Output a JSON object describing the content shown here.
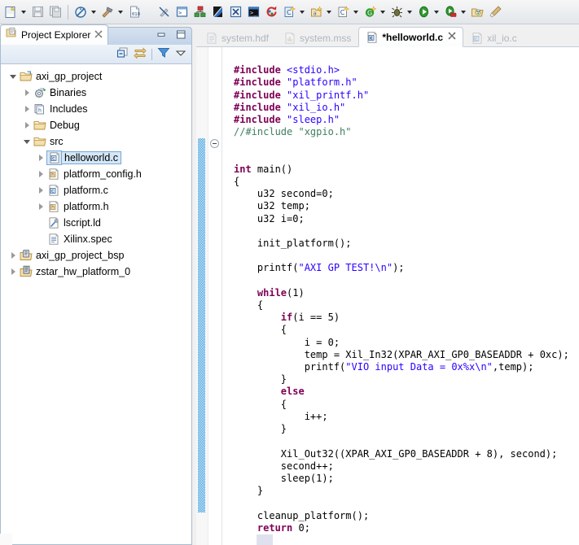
{
  "toolbar": {
    "items": [
      {
        "name": "new-button",
        "icon": "new-file-icon",
        "dropdown": true
      },
      {
        "name": "save-button",
        "icon": "save-icon",
        "dropdown": false
      },
      {
        "name": "save-all-button",
        "icon": "save-all-icon",
        "dropdown": false
      },
      {
        "name": "separator-1",
        "icon": "separator",
        "dropdown": false
      },
      {
        "name": "skip-breakpoints-button",
        "icon": "skip-breakpoints-icon",
        "dropdown": true
      },
      {
        "name": "build-button",
        "icon": "hammer-build-icon",
        "dropdown": true
      },
      {
        "name": "binary-editor-button",
        "icon": "binary-file-icon",
        "dropdown": false
      },
      {
        "name": "spacer-1",
        "icon": "gap",
        "dropdown": false
      },
      {
        "name": "toggle-markers-button",
        "icon": "crossed-pencil-icon",
        "dropdown": false
      },
      {
        "name": "terminal-button",
        "icon": "terminal-icon",
        "dropdown": false
      },
      {
        "name": "program-fpga-button",
        "icon": "green-blocks-icon",
        "dropdown": false
      },
      {
        "name": "xsct-console-button",
        "icon": "blue-diagonal-icon",
        "dropdown": false
      },
      {
        "name": "xilinx-tools-button",
        "icon": "xilinx-x-icon",
        "dropdown": false
      },
      {
        "name": "launch-shell-button",
        "icon": "dark-terminal-icon",
        "dropdown": false
      },
      {
        "name": "refresh-button",
        "icon": "red-refresh-icon",
        "dropdown": false
      },
      {
        "name": "new-c-project-button",
        "icon": "c-new-icon",
        "dropdown": true
      },
      {
        "name": "new-app-project-button",
        "icon": "a-new-icon",
        "dropdown": true
      },
      {
        "name": "new-c-file-button",
        "icon": "c-file-new-icon",
        "dropdown": true
      },
      {
        "name": "new-bsp-button",
        "icon": "green-g-new-icon",
        "dropdown": true
      },
      {
        "name": "debug-button",
        "icon": "bug-icon",
        "dropdown": true
      },
      {
        "name": "run-button",
        "icon": "green-play-icon",
        "dropdown": true
      },
      {
        "name": "profile-button",
        "icon": "profile-icon",
        "dropdown": true
      },
      {
        "name": "open-perspective-button",
        "icon": "open-folder-palette-icon",
        "dropdown": false
      },
      {
        "name": "customize-perspective-button",
        "icon": "paintbrush-icon",
        "dropdown": false
      }
    ]
  },
  "project_explorer": {
    "tab_title": "Project Explorer",
    "tab_close_glyph": "✕",
    "minimize_glyph": "minimize-icon",
    "maximize_glyph": "maximize-icon",
    "view_tools": [
      {
        "name": "collapse-all-button",
        "icon": "collapse-all-icon"
      },
      {
        "name": "link-with-editor-button",
        "icon": "link-editor-icon"
      },
      {
        "name": "filters-button",
        "icon": "filter-funnel-icon"
      },
      {
        "name": "view-menu-button",
        "icon": "chevron-down-icon"
      }
    ],
    "tree": [
      {
        "label": "axi_gp_project",
        "depth": 0,
        "twisty": "open",
        "icon": "project-folder-icon",
        "selected": false
      },
      {
        "label": "Binaries",
        "depth": 1,
        "twisty": "closed",
        "icon": "binaries-icon",
        "selected": false
      },
      {
        "label": "Includes",
        "depth": 1,
        "twisty": "closed",
        "icon": "includes-icon",
        "selected": false
      },
      {
        "label": "Debug",
        "depth": 1,
        "twisty": "closed",
        "icon": "folder-icon",
        "selected": false
      },
      {
        "label": "src",
        "depth": 1,
        "twisty": "open",
        "icon": "folder-icon",
        "selected": false
      },
      {
        "label": "helloworld.c",
        "depth": 2,
        "twisty": "closed",
        "icon": "c-source-file-icon",
        "selected": true
      },
      {
        "label": "platform_config.h",
        "depth": 2,
        "twisty": "closed",
        "icon": "h-header-file-icon",
        "selected": false
      },
      {
        "label": "platform.c",
        "depth": 2,
        "twisty": "closed",
        "icon": "c-source-file-icon",
        "selected": false
      },
      {
        "label": "platform.h",
        "depth": 2,
        "twisty": "closed",
        "icon": "h-header-file-icon",
        "selected": false
      },
      {
        "label": "lscript.ld",
        "depth": 2,
        "twisty": "none",
        "icon": "linker-script-icon",
        "selected": false
      },
      {
        "label": "Xilinx.spec",
        "depth": 2,
        "twisty": "none",
        "icon": "spec-file-icon",
        "selected": false
      },
      {
        "label": "axi_gp_project_bsp",
        "depth": 0,
        "twisty": "closed",
        "icon": "bsp-project-icon",
        "selected": false
      },
      {
        "label": "zstar_hw_platform_0",
        "depth": 0,
        "twisty": "closed",
        "icon": "hw-platform-icon",
        "selected": false
      }
    ]
  },
  "editor": {
    "tabs": [
      {
        "label": "system.hdf",
        "icon": "hdf-file-icon",
        "active": false,
        "dirty": false,
        "closable": false
      },
      {
        "label": "system.mss",
        "icon": "mss-file-icon",
        "active": false,
        "dirty": false,
        "closable": false
      },
      {
        "label": "*helloworld.c",
        "icon": "c-source-file-icon",
        "active": true,
        "dirty": true,
        "closable": true
      },
      {
        "label": "xil_io.c",
        "icon": "c-source-file-icon",
        "active": false,
        "dirty": false,
        "closable": false
      }
    ],
    "close_glyph": "✕",
    "code_lines": [
      {
        "indent": 0,
        "tokens": []
      },
      {
        "indent": 0,
        "tokens": [
          {
            "t": "pp",
            "v": "#include "
          },
          {
            "t": "s",
            "v": "<stdio.h>"
          }
        ]
      },
      {
        "indent": 0,
        "tokens": [
          {
            "t": "pp",
            "v": "#include "
          },
          {
            "t": "s",
            "v": "\"platform.h\""
          }
        ]
      },
      {
        "indent": 0,
        "tokens": [
          {
            "t": "pp",
            "v": "#include "
          },
          {
            "t": "s",
            "v": "\"xil_printf.h\""
          }
        ]
      },
      {
        "indent": 0,
        "tokens": [
          {
            "t": "pp",
            "v": "#include "
          },
          {
            "t": "s",
            "v": "\"xil_io.h\""
          }
        ]
      },
      {
        "indent": 0,
        "tokens": [
          {
            "t": "pp",
            "v": "#include "
          },
          {
            "t": "s",
            "v": "\"sleep.h\""
          }
        ]
      },
      {
        "indent": 0,
        "tokens": [
          {
            "t": "cm",
            "v": "//#include \"xgpio.h\""
          }
        ]
      },
      {
        "indent": 0,
        "tokens": []
      },
      {
        "indent": 0,
        "tokens": []
      },
      {
        "indent": 0,
        "tokens": [
          {
            "t": "k",
            "v": "int"
          },
          {
            "t": "pl",
            "v": " main()"
          }
        ]
      },
      {
        "indent": 0,
        "tokens": [
          {
            "t": "pl",
            "v": "{"
          }
        ]
      },
      {
        "indent": 1,
        "tokens": [
          {
            "t": "pl",
            "v": "u32 second=0;"
          }
        ]
      },
      {
        "indent": 1,
        "tokens": [
          {
            "t": "pl",
            "v": "u32 temp;"
          }
        ]
      },
      {
        "indent": 1,
        "tokens": [
          {
            "t": "pl",
            "v": "u32 i=0;"
          }
        ]
      },
      {
        "indent": 0,
        "tokens": []
      },
      {
        "indent": 1,
        "tokens": [
          {
            "t": "pl",
            "v": "init_platform();"
          }
        ]
      },
      {
        "indent": 0,
        "tokens": []
      },
      {
        "indent": 1,
        "tokens": [
          {
            "t": "pl",
            "v": "printf("
          },
          {
            "t": "s",
            "v": "\"AXI GP TEST!\\n\""
          },
          {
            "t": "pl",
            "v": ");"
          }
        ]
      },
      {
        "indent": 0,
        "tokens": []
      },
      {
        "indent": 1,
        "tokens": [
          {
            "t": "k",
            "v": "while"
          },
          {
            "t": "pl",
            "v": "(1)"
          }
        ]
      },
      {
        "indent": 1,
        "tokens": [
          {
            "t": "pl",
            "v": "{"
          }
        ]
      },
      {
        "indent": 2,
        "tokens": [
          {
            "t": "k",
            "v": "if"
          },
          {
            "t": "pl",
            "v": "(i == 5)"
          }
        ]
      },
      {
        "indent": 2,
        "tokens": [
          {
            "t": "pl",
            "v": "{"
          }
        ]
      },
      {
        "indent": 3,
        "tokens": [
          {
            "t": "pl",
            "v": "i = 0;"
          }
        ]
      },
      {
        "indent": 3,
        "tokens": [
          {
            "t": "pl",
            "v": "temp = Xil_In32(XPAR_AXI_GP0_BASEADDR + 0xc);"
          }
        ]
      },
      {
        "indent": 3,
        "tokens": [
          {
            "t": "pl",
            "v": "printf("
          },
          {
            "t": "s",
            "v": "\"VIO input Data = 0x%x\\n\""
          },
          {
            "t": "pl",
            "v": ",temp);"
          }
        ]
      },
      {
        "indent": 2,
        "tokens": [
          {
            "t": "pl",
            "v": "}"
          }
        ]
      },
      {
        "indent": 2,
        "tokens": [
          {
            "t": "k",
            "v": "else"
          }
        ]
      },
      {
        "indent": 2,
        "tokens": [
          {
            "t": "pl",
            "v": "{"
          }
        ]
      },
      {
        "indent": 3,
        "tokens": [
          {
            "t": "pl",
            "v": "i++;"
          }
        ]
      },
      {
        "indent": 2,
        "tokens": [
          {
            "t": "pl",
            "v": "}"
          }
        ]
      },
      {
        "indent": 0,
        "tokens": []
      },
      {
        "indent": 2,
        "tokens": [
          {
            "t": "pl",
            "v": "Xil_Out32((XPAR_AXI_GP0_BASEADDR + 8), second);"
          }
        ]
      },
      {
        "indent": 2,
        "tokens": [
          {
            "t": "pl",
            "v": "second++;"
          }
        ]
      },
      {
        "indent": 2,
        "tokens": [
          {
            "t": "pl",
            "v": "sleep(1);"
          }
        ]
      },
      {
        "indent": 1,
        "tokens": [
          {
            "t": "pl",
            "v": "}"
          }
        ]
      },
      {
        "indent": 0,
        "tokens": []
      },
      {
        "indent": 1,
        "tokens": [
          {
            "t": "pl",
            "v": "cleanup_platform();"
          }
        ]
      },
      {
        "indent": 1,
        "tokens": [
          {
            "t": "k",
            "v": "return"
          },
          {
            "t": "pl",
            "v": " 0;"
          }
        ]
      },
      {
        "indent": 0,
        "tokens": [
          {
            "t": "pl",
            "v": "}"
          }
        ]
      }
    ]
  },
  "colors": {
    "keyword": "#7f0055",
    "string": "#2a00ff",
    "comment": "#3f7f5f",
    "plain": "#000000",
    "change_bar": "#1f8fd8",
    "selection": "#d4e7f7",
    "tab_active_border": "#c4ccd6"
  }
}
